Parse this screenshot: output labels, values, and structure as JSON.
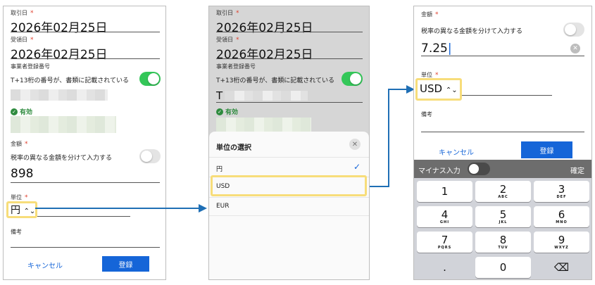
{
  "screen1": {
    "txn_date_label": "取引日",
    "txn_date_value": "2026年02月25日",
    "recv_date_label": "受領日",
    "recv_date_value": "2026年02月25日",
    "reg_no_label": "事業者登録番号",
    "reg_no_toggle_text": "T+13桁の番号が、書類に記載されている",
    "valid_text": "有効",
    "amount_label": "金額",
    "split_tax_text": "税率の異なる金額を分けて入力する",
    "amount_value": "898",
    "unit_label": "単位",
    "unit_value": "円",
    "memo_label": "備考",
    "cancel_label": "キャンセル",
    "register_label": "登録"
  },
  "screen2": {
    "txn_date_label": "取引日",
    "txn_date_value": "2026年02月25日",
    "recv_date_label": "受領日",
    "recv_date_value": "2026年02月25日",
    "reg_no_label": "事業者登録番号",
    "reg_no_toggle_text": "T+13桁の番号が、書類に記載されている",
    "reg_no_prefix": "T",
    "valid_text": "有効",
    "sheet_title": "単位の選択",
    "options": [
      "円",
      "USD",
      "EUR"
    ],
    "selected_check": "✓"
  },
  "screen3": {
    "amount_label": "金額",
    "split_tax_text": "税率の異なる金額を分けて入力する",
    "amount_value": "7.25",
    "unit_label": "単位",
    "unit_value": "USD",
    "memo_label": "備考",
    "cancel_label": "キャンセル",
    "register_label": "登録",
    "minus_input_label": "マイナス入力",
    "confirm_label": "確定",
    "keys": [
      {
        "n": "1",
        "s": ""
      },
      {
        "n": "2",
        "s": "ABC"
      },
      {
        "n": "3",
        "s": "DEF"
      },
      {
        "n": "4",
        "s": "GHI"
      },
      {
        "n": "5",
        "s": "JKL"
      },
      {
        "n": "6",
        "s": "MNO"
      },
      {
        "n": "7",
        "s": "PQRS"
      },
      {
        "n": "8",
        "s": "TUV"
      },
      {
        "n": "9",
        "s": "WXYZ"
      },
      {
        "n": ".",
        "s": ""
      },
      {
        "n": "0",
        "s": ""
      },
      {
        "n": "⌫",
        "s": ""
      }
    ]
  },
  "colors": {
    "accent_blue": "#1565d8",
    "toggle_green": "#34c759",
    "highlight_yellow": "#f7dd7a",
    "required_red": "#e0402e",
    "valid_green": "#2e8b3e"
  }
}
